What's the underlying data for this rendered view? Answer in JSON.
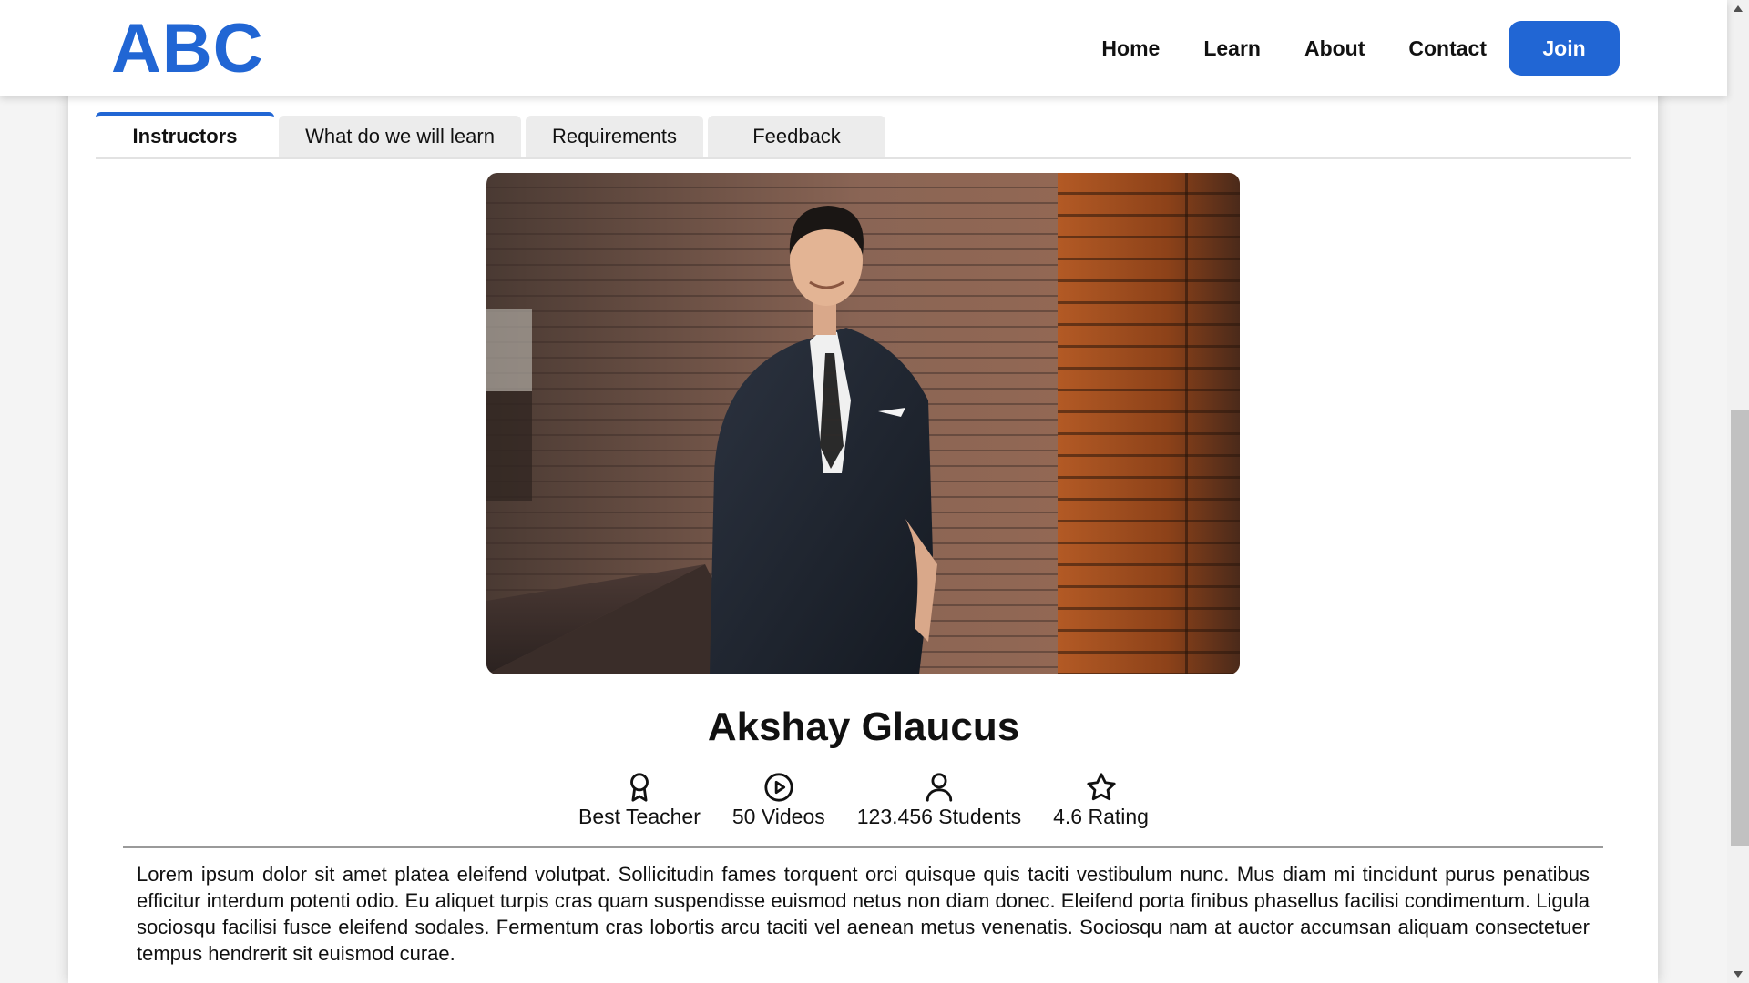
{
  "brand": {
    "logo_text": "ABC",
    "accent": "#2166d4"
  },
  "nav": {
    "links": [
      "Home",
      "Learn",
      "About",
      "Contact"
    ],
    "join_label": "Join"
  },
  "tabs": [
    {
      "label": "Instructors",
      "active": true
    },
    {
      "label": "What do we will learn",
      "active": false
    },
    {
      "label": "Requirements",
      "active": false
    },
    {
      "label": "Feedback",
      "active": false
    }
  ],
  "instructor": {
    "name": "Akshay Glaucus",
    "stats": [
      {
        "icon": "award-icon",
        "label": "Best Teacher"
      },
      {
        "icon": "play-circle-icon",
        "label": "50 Videos"
      },
      {
        "icon": "user-icon",
        "label": "123.456 Students"
      },
      {
        "icon": "star-icon",
        "label": "4.6 Rating"
      }
    ],
    "bio": "Lorem ipsum dolor sit amet platea eleifend volutpat. Sollicitudin fames torquent orci quisque quis taciti vestibulum nunc. Mus diam mi tincidunt purus penatibus efficitur interdum potenti odio. Eu aliquet turpis cras quam suspendisse euismod netus non diam donec. Eleifend porta finibus phasellus facilisi condimentum. Ligula sociosqu facilisi fusce eleifend sodales. Fermentum cras lobortis arcu taciti vel aenean metus venenatis. Sociosqu nam at auctor accumsan aliquam consectetuer tempus hendrerit sit euismod curae."
  }
}
